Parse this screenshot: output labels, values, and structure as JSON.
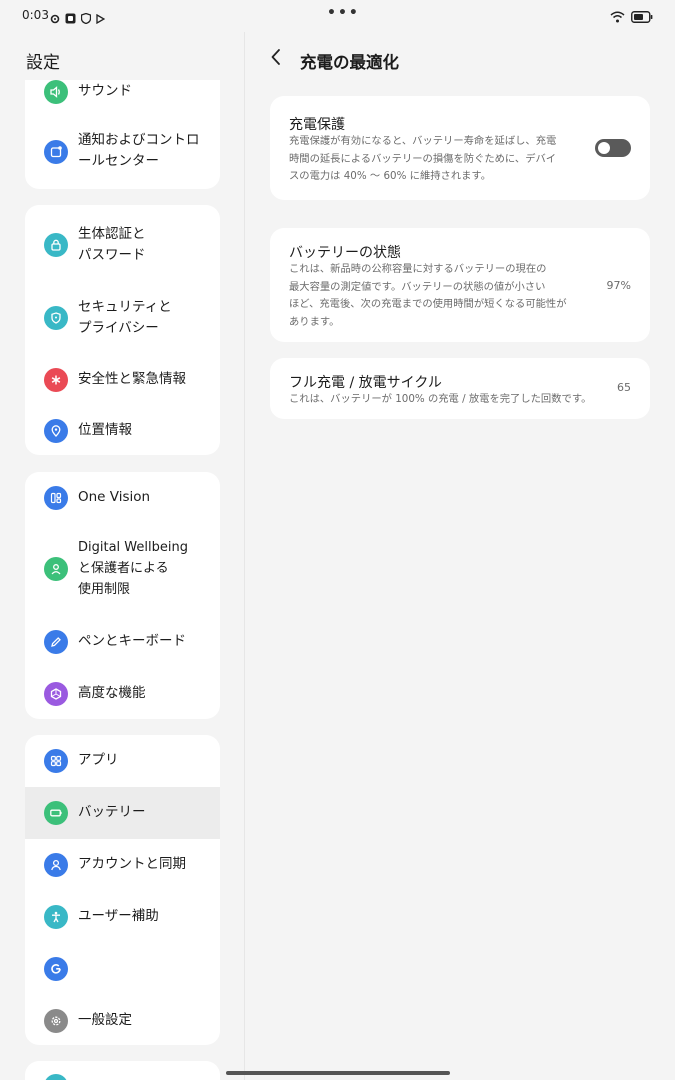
{
  "status_bar": {
    "time": "0:03",
    "left_icons": [
      "settings-gear-icon",
      "square-app-icon",
      "shield-icon",
      "play-icon"
    ],
    "right_icons": [
      "wifi-icon",
      "battery-icon"
    ]
  },
  "sidebar": {
    "title": "設定",
    "groups": [
      {
        "items": [
          {
            "label": "サウンド",
            "icon": "speaker-icon",
            "color": "#3cc07a"
          },
          {
            "label": "通知およびコントロールセンター",
            "icon": "notification-icon",
            "color": "#3a7be8"
          }
        ]
      },
      {
        "items": [
          {
            "label": "生体認証と\nパスワード",
            "icon": "lock-icon",
            "color": "#39b8c6"
          },
          {
            "label": "セキュリティと\nプライバシー",
            "icon": "security-shield-icon",
            "color": "#39b8c6"
          },
          {
            "label": "安全性と緊急情報",
            "icon": "emergency-icon",
            "color": "#ea4a55"
          },
          {
            "label": "位置情報",
            "icon": "location-icon",
            "color": "#3a7be8"
          }
        ]
      },
      {
        "items": [
          {
            "label": "One Vision",
            "icon": "one-vision-icon",
            "color": "#3a7be8"
          },
          {
            "label": "Digital Wellbeing\nと保護者による\n使用制限",
            "icon": "wellbeing-icon",
            "color": "#3cc07a"
          },
          {
            "label": "ペンとキーボード",
            "icon": "pen-icon",
            "color": "#3a7be8"
          },
          {
            "label": "高度な機能",
            "icon": "advanced-features-icon",
            "color": "#9a5ae0"
          }
        ]
      },
      {
        "items": [
          {
            "label": "アプリ",
            "icon": "apps-grid-icon",
            "color": "#3a7be8"
          },
          {
            "label": "バッテリー",
            "icon": "battery-icon",
            "color": "#3cc07a",
            "selected": true
          },
          {
            "label": "アカウントと同期",
            "icon": "account-icon",
            "color": "#3a7be8"
          },
          {
            "label": "ユーザー補助",
            "icon": "accessibility-icon",
            "color": "#39b8c6"
          },
          {
            "label": "",
            "icon": "google-icon",
            "color": "#3a7be8"
          },
          {
            "label": "一般設定",
            "icon": "gear-icon",
            "color": "#8a8a8a"
          }
        ]
      }
    ]
  },
  "main": {
    "title": "充電の最適化",
    "cards": [
      {
        "title": "充電保護",
        "description": "充電保護が有効になると、バッテリー寿命を延ばし、充電\n時間の延長によるバッテリーの損傷を防ぐために、デバイ\nスの電力は 40% ～ 60% に維持されます。",
        "toggle_on": false
      },
      {
        "title": "バッテリーの状態",
        "description": "これは、新品時の公称容量に対するバッテリーの現在の\n最大容量の測定値です。バッテリーの状態の値が小さい\nほど、充電後、次の充電までの使用時間が短くなる可能性が\nあります。",
        "value": "97%"
      },
      {
        "title": "フル充電 / 放電サイクル",
        "description": "これは、バッテリーが 100% の充電 / 放電を完了した回数です。",
        "value": "65"
      }
    ]
  }
}
